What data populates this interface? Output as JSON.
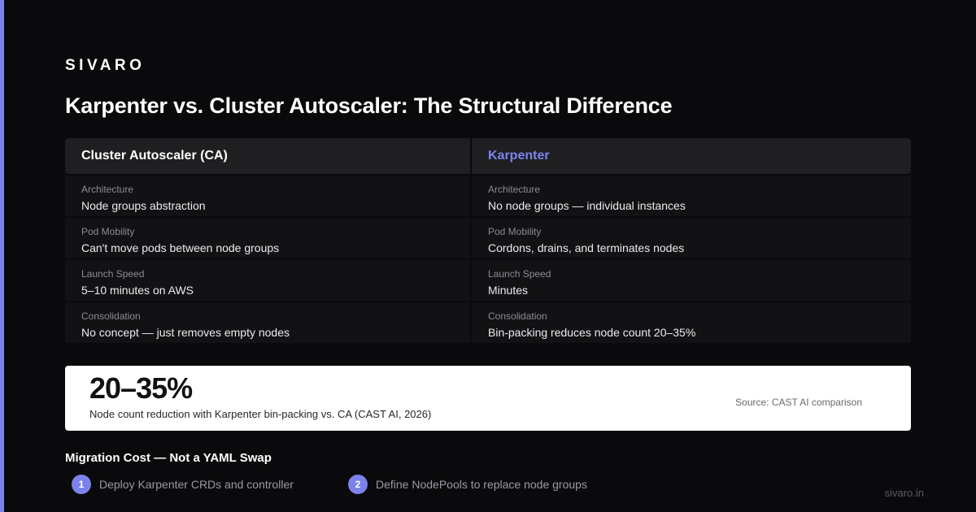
{
  "brand": {
    "logo": "SIVARO",
    "url": "sivaro.in",
    "accent_color": "#7b83eb"
  },
  "title": "Karpenter vs. Cluster Autoscaler: The Structural Difference",
  "comparison": {
    "left": {
      "heading": "Cluster Autoscaler (CA)",
      "rows": [
        {
          "label": "Architecture",
          "value": "Node groups abstraction"
        },
        {
          "label": "Pod Mobility",
          "value": "Can't move pods between node groups"
        },
        {
          "label": "Launch Speed",
          "value": "5–10 minutes on AWS"
        },
        {
          "label": "Consolidation",
          "value": "No concept — just removes empty nodes"
        }
      ]
    },
    "right": {
      "heading": "Karpenter",
      "rows": [
        {
          "label": "Architecture",
          "value": "No node groups — individual instances"
        },
        {
          "label": "Pod Mobility",
          "value": "Cordons, drains, and terminates nodes"
        },
        {
          "label": "Launch Speed",
          "value": "Minutes"
        },
        {
          "label": "Consolidation",
          "value": "Bin-packing reduces node count 20–35%"
        }
      ]
    }
  },
  "stat": {
    "number": "20–35%",
    "caption": "Node count reduction with Karpenter bin-packing vs. CA (CAST AI, 2026)",
    "source": "Source: CAST AI comparison"
  },
  "migration": {
    "title": "Migration Cost — Not a YAML Swap",
    "steps": [
      {
        "number": "1",
        "text": "Deploy Karpenter CRDs and controller"
      },
      {
        "number": "2",
        "text": "Define NodePools to replace node groups"
      }
    ]
  }
}
